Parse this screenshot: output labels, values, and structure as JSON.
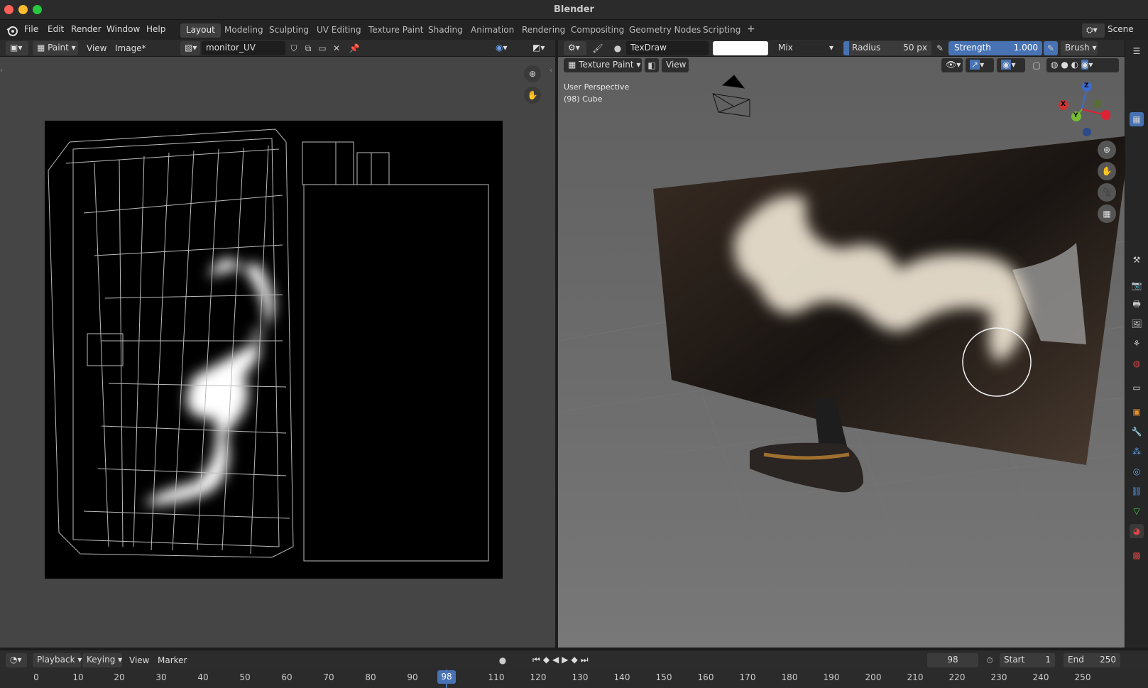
{
  "app": {
    "title": "Blender"
  },
  "menu": [
    "File",
    "Edit",
    "Render",
    "Window",
    "Help"
  ],
  "workspaces": [
    "Layout",
    "Modeling",
    "Sculpting",
    "UV Editing",
    "Texture Paint",
    "Shading",
    "Animation",
    "Rendering",
    "Compositing",
    "Geometry Nodes",
    "Scripting"
  ],
  "active_workspace": "Layout",
  "scene": "Scene",
  "image_editor": {
    "mode": "Paint",
    "view_label": "View",
    "image_menu": "Image*",
    "image_name": "monitor_UV"
  },
  "viewport": {
    "mode": "Texture Paint",
    "view_label": "View",
    "perspective": "User Perspective",
    "object_info": "(98) Cube",
    "brush_name": "TexDraw",
    "blend": "Mix",
    "radius_label": "Radius",
    "radius_value": "50 px",
    "strength_label": "Strength",
    "strength_value": "1.000",
    "brush_menu": "Brush",
    "gizmo": {
      "x": "X",
      "y": "Y",
      "z": "Z"
    }
  },
  "timeline": {
    "playback": "Playback",
    "keying": "Keying",
    "view": "View",
    "marker": "Marker",
    "current_frame": "98",
    "start_label": "Start",
    "start": "1",
    "end_label": "End",
    "end": "250",
    "ticks": [
      "0",
      "10",
      "20",
      "30",
      "40",
      "50",
      "60",
      "70",
      "80",
      "90",
      "110",
      "120",
      "130",
      "140",
      "150",
      "160",
      "170",
      "180",
      "190",
      "200",
      "210",
      "220",
      "230",
      "240",
      "250"
    ],
    "playhead": "98"
  },
  "colors": {
    "accent": "#4772b3",
    "background": "#1d1d1d",
    "panel": "#2c2c2c"
  }
}
